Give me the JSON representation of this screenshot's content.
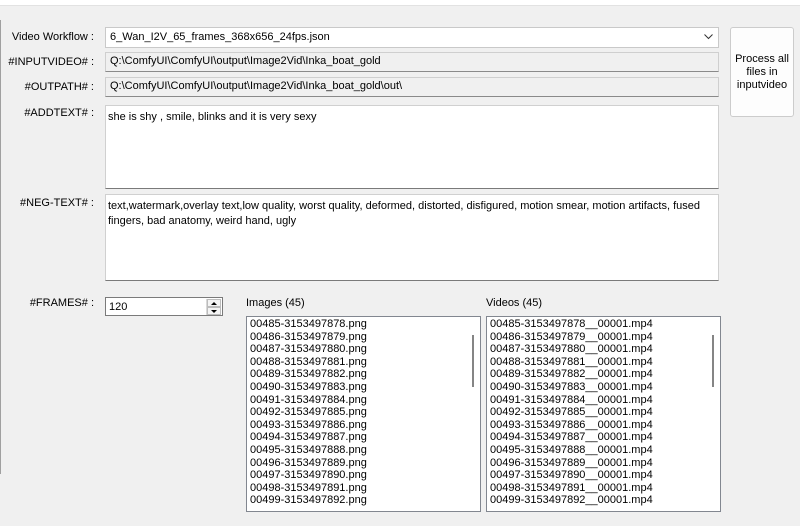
{
  "labels": {
    "workflow": "Video Workflow :",
    "inputvideo": "#INPUTVIDEO# :",
    "outpath": "#OUTPATH# :",
    "addtext": "#ADDTEXT# :",
    "negtext": "#NEG-TEXT# :",
    "frames": "#FRAMES# :"
  },
  "workflow_select": {
    "value": "6_Wan_I2V_65_frames_368x656_24fps.json",
    "icon": "chevron-down-icon"
  },
  "inputvideo_value": "Q:\\ComfyUI\\ComfyUI\\output\\Image2Vid\\Inka_boat_gold",
  "outpath_value": "Q:\\ComfyUI\\ComfyUI\\output\\Image2Vid\\Inka_boat_gold\\out\\",
  "addtext_value": "she is shy , smile, blinks and it is very sexy",
  "negtext_value": "text,watermark,overlay text,low quality, worst quality, deformed, distorted, disfigured, motion smear, motion artifacts, fused fingers, bad anatomy, weird hand, ugly",
  "frames_value": "120",
  "process_button": "Process all files in inputvideo",
  "images": {
    "title": "Images (45)",
    "items": [
      "00485-3153497878.png",
      "00486-3153497879.png",
      "00487-3153497880.png",
      "00488-3153497881.png",
      "00489-3153497882.png",
      "00490-3153497883.png",
      "00491-3153497884.png",
      "00492-3153497885.png",
      "00493-3153497886.png",
      "00494-3153497887.png",
      "00495-3153497888.png",
      "00496-3153497889.png",
      "00497-3153497890.png",
      "00498-3153497891.png",
      "00499-3153497892.png"
    ]
  },
  "videos": {
    "title": "Videos (45)",
    "items": [
      "00485-3153497878__00001.mp4",
      "00486-3153497879__00001.mp4",
      "00487-3153497880__00001.mp4",
      "00488-3153497881__00001.mp4",
      "00489-3153497882__00001.mp4",
      "00490-3153497883__00001.mp4",
      "00491-3153497884__00001.mp4",
      "00492-3153497885__00001.mp4",
      "00493-3153497886__00001.mp4",
      "00494-3153497887__00001.mp4",
      "00495-3153497888__00001.mp4",
      "00496-3153497889__00001.mp4",
      "00497-3153497890__00001.mp4",
      "00498-3153497891__00001.mp4",
      "00499-3153497892__00001.mp4"
    ]
  }
}
